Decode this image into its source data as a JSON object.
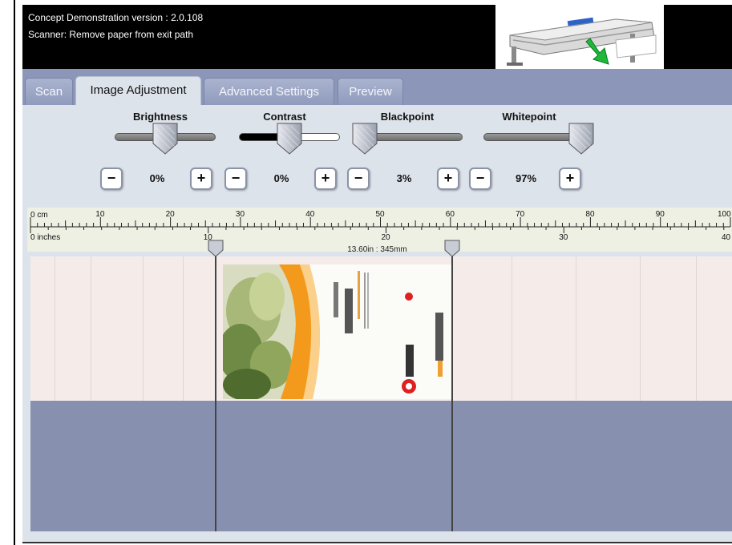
{
  "status": {
    "line1": "Concept Demonstration version : 2.0.108",
    "line2": "Scanner: Remove paper from exit path"
  },
  "tabs": [
    {
      "label": "Scan",
      "active": false
    },
    {
      "label": "Image Adjustment",
      "active": true
    },
    {
      "label": "Advanced Settings",
      "active": false
    },
    {
      "label": "Preview",
      "active": false
    }
  ],
  "controls": {
    "brightness": {
      "label": "Brightness",
      "value": "0%",
      "level": 0.5
    },
    "contrast": {
      "label": "Contrast",
      "value": "0%",
      "level": 0.5
    },
    "blackpoint": {
      "label": "Blackpoint",
      "value": "3%",
      "level": 0.03
    },
    "whitepoint": {
      "label": "Whitepoint",
      "value": "97%",
      "level": 0.97
    },
    "minus_label": "−",
    "plus_label": "+"
  },
  "ruler": {
    "cm_label": "0 cm",
    "inch_label": "0 inches",
    "cm_ticks": [
      "10",
      "20",
      "30",
      "40",
      "50",
      "60",
      "70",
      "80",
      "90",
      "100"
    ],
    "inch_ticks": [
      "10",
      "20",
      "30",
      "40"
    ]
  },
  "selection": {
    "width_label": "13.60in : 345mm"
  },
  "colors": {
    "status_bar": "#000000",
    "tab_strip": "#8c96b8",
    "panel": "#dde3ea",
    "preview_bg": "#8890b0",
    "ruler_bg": "#eef0e4"
  },
  "icons": {
    "scanner": "scanner-paper-exit-icon",
    "handle": "crop-handle-icon"
  }
}
